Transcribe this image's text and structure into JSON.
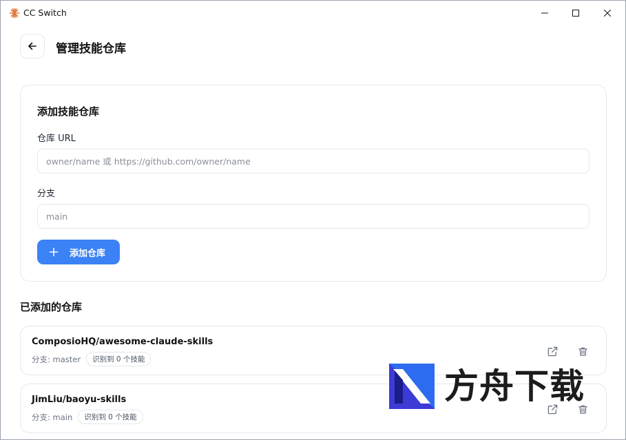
{
  "app": {
    "title": "CC Switch",
    "accent_color": "#3b82f6"
  },
  "window_controls": {
    "minimize": "minimize-icon",
    "maximize": "maximize-icon",
    "close": "close-icon"
  },
  "header": {
    "back_icon": "arrow-left-icon",
    "title": "管理技能仓库"
  },
  "add_repo": {
    "title": "添加技能仓库",
    "url_label": "仓库 URL",
    "url_placeholder": "owner/name 或 https://github.com/owner/name",
    "url_value": "",
    "branch_label": "分支",
    "branch_placeholder": "main",
    "branch_value": "",
    "add_button_label": "添加仓库"
  },
  "added_repos": {
    "title": "已添加的仓库",
    "items": [
      {
        "name": "ComposioHQ/awesome-claude-skills",
        "branch": "分支: master",
        "skills": "识别到 0 个技能"
      },
      {
        "name": "JimLiu/baoyu-skills",
        "branch": "分支: main",
        "skills": "识别到 0 个技能"
      }
    ]
  },
  "watermark": {
    "text": "方舟下载"
  }
}
